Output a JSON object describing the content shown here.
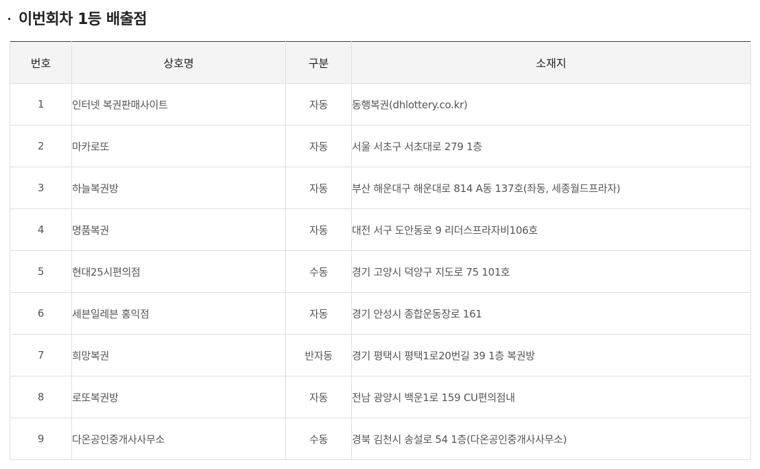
{
  "section": {
    "title": "이번회차 1등 배출점"
  },
  "table": {
    "headers": {
      "no": "번호",
      "name": "상호명",
      "type": "구분",
      "address": "소재지"
    },
    "rows": [
      {
        "no": "1",
        "name": "인터넷 복권판매사이트",
        "type": "자동",
        "address": "동행복권(dhlottery.co.kr)"
      },
      {
        "no": "2",
        "name": "마카로또",
        "type": "자동",
        "address": "서울 서초구 서초대로 279 1층"
      },
      {
        "no": "3",
        "name": "하늘복권방",
        "type": "자동",
        "address": "부산 해운대구 해운대로 814 A동 137호(좌동, 세종월드프라자)"
      },
      {
        "no": "4",
        "name": "명품복권",
        "type": "자동",
        "address": "대전 서구 도안동로 9 리더스프라자비106호"
      },
      {
        "no": "5",
        "name": "현대25시편의점",
        "type": "수동",
        "address": "경기 고양시 덕양구 지도로 75 101호"
      },
      {
        "no": "6",
        "name": "세븐일레븐 홍익점",
        "type": "자동",
        "address": "경기 안성시 종합운동장로 161"
      },
      {
        "no": "7",
        "name": "희망복권",
        "type": "반자동",
        "address": "경기 평택시 평택1로20번길 39 1층 복권방"
      },
      {
        "no": "8",
        "name": "로또복권방",
        "type": "자동",
        "address": "전남 광양시 백운1로 159 CU편의점내"
      },
      {
        "no": "9",
        "name": "다온공인중개사사무소",
        "type": "수동",
        "address": "경북 김천시 송설로 54 1층(다온공인중개사사무소)"
      }
    ]
  }
}
